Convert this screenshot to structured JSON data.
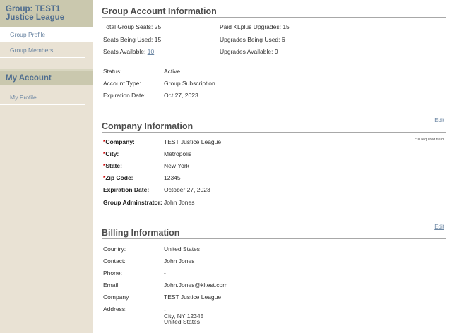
{
  "sidebar": {
    "group_title": "Group: TEST1 Justice League",
    "group_items": [
      {
        "label": "Group Profile",
        "active": true
      },
      {
        "label": "Group Members",
        "active": false
      }
    ],
    "account_title": "My Account",
    "account_items": [
      {
        "label": "My Profile"
      }
    ]
  },
  "group_account": {
    "title": "Group Account Information",
    "total_seats_label": "Total Group Seats:",
    "total_seats": "25",
    "seats_used_label": "Seats Being Used:",
    "seats_used": "15",
    "seats_available_label": "Seats Available:",
    "seats_available": "10",
    "paid_upgrades_label": "Paid KLplus Upgrades:",
    "paid_upgrades": "15",
    "upgrades_used_label": "Upgrades Being Used:",
    "upgrades_used": "6",
    "upgrades_available_label": "Upgrades Available:",
    "upgrades_available": "9",
    "status_label": "Status:",
    "status": "Active",
    "account_type_label": "Account Type:",
    "account_type": "Group Subscription",
    "expiration_label": "Expiration Date:",
    "expiration": "Oct 27, 2023"
  },
  "company": {
    "title": "Company Information",
    "edit_label": "Edit",
    "required_note": "* = required field",
    "required_mark": "*",
    "company_label": "Company:",
    "company": "TEST Justice League",
    "city_label": "City:",
    "city": "Metropolis",
    "state_label": "State:",
    "state": "New York",
    "zip_label": "Zip Code:",
    "zip": "12345",
    "expiration_label": "Expiration Date:",
    "expiration": "October 27, 2023",
    "admin_label": "Group Adminstrator:",
    "admin": "John Jones"
  },
  "billing": {
    "title": "Billing Information",
    "edit_label": "Edit",
    "country_label": "Country:",
    "country": "United States",
    "contact_label": "Contact:",
    "contact": "John Jones",
    "phone_label": "Phone:",
    "phone": "-",
    "email_label": "Email",
    "email": "John.Jones@kltest.com",
    "company_label": "Company",
    "company": "TEST Justice League",
    "address_label": "Address:",
    "address_line1": "-",
    "address_line2": "City, NY 12345",
    "address_line3": "United States"
  }
}
